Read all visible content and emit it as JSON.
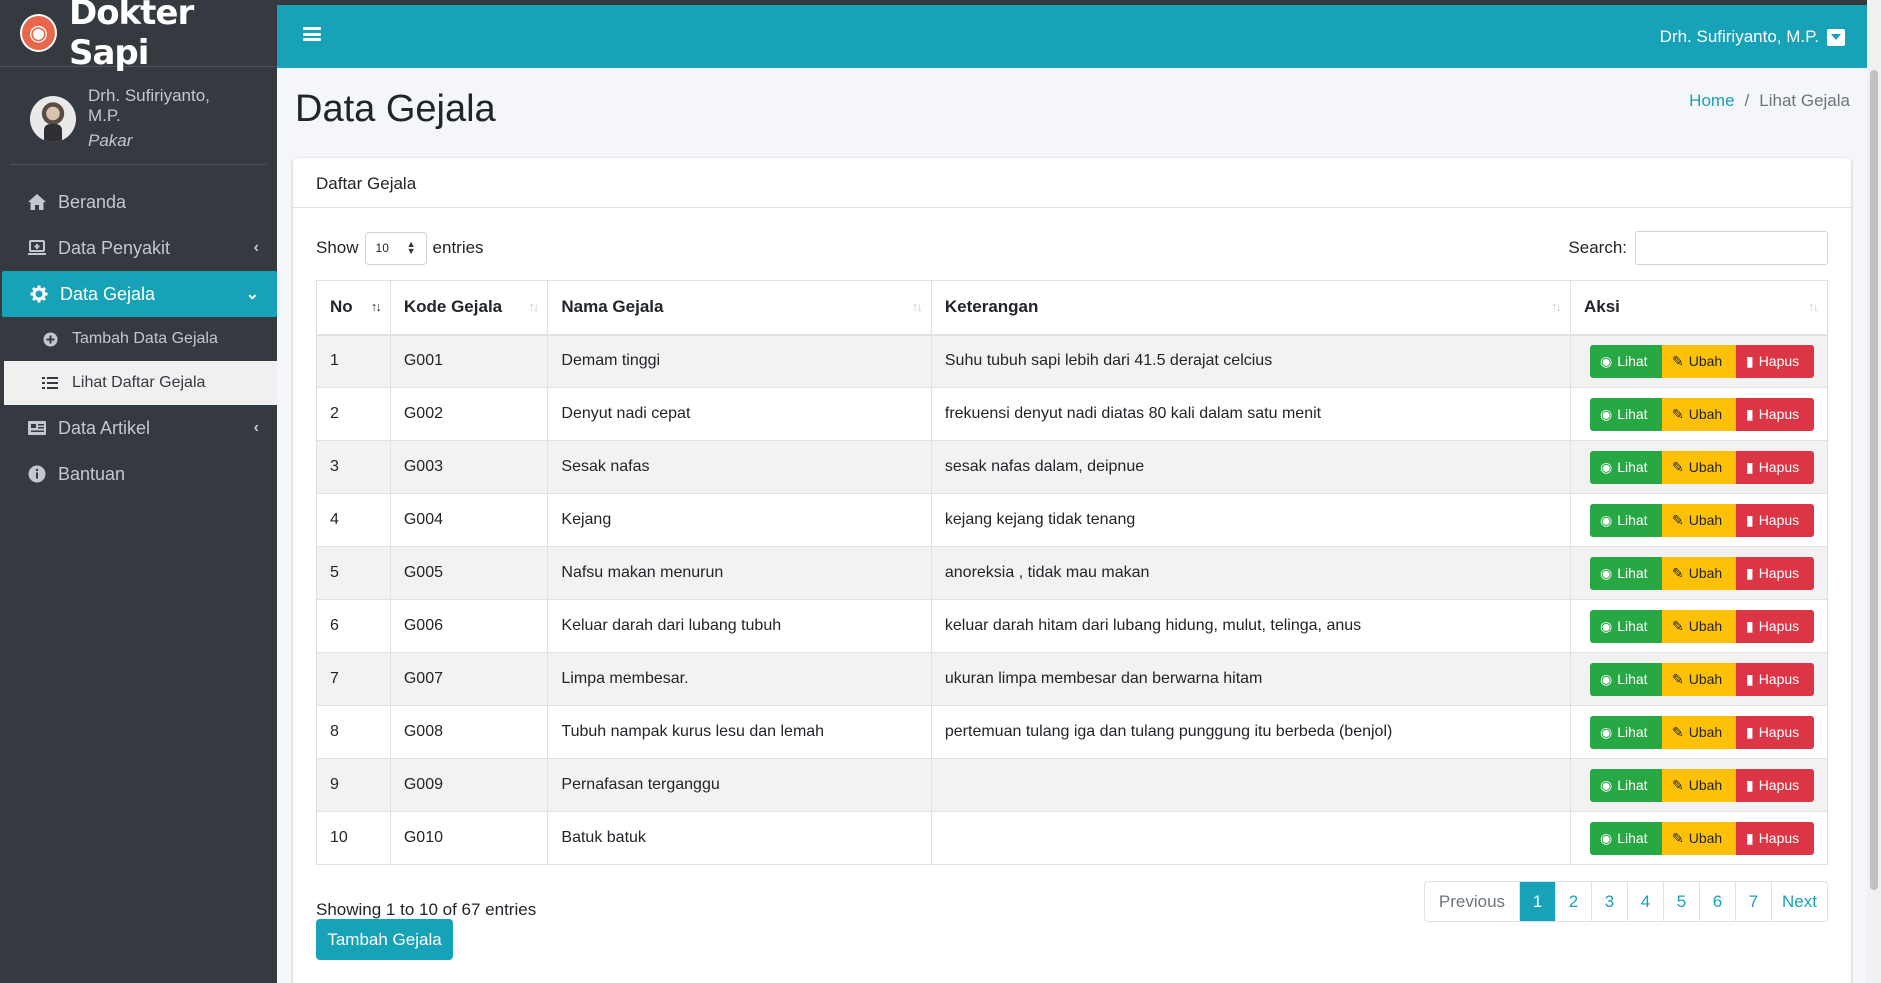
{
  "brand": {
    "name": "Dokter Sapi",
    "logo_icon": "cow-icon"
  },
  "sidebar": {
    "user": {
      "name": "Drh. Sufiriyanto, M.P.",
      "role": "Pakar"
    },
    "items": [
      {
        "label": "Beranda",
        "icon": "home-icon"
      },
      {
        "label": "Data Penyakit",
        "icon": "laptop-medical-icon"
      },
      {
        "label": "Data Gejala",
        "icon": "gear-icon"
      },
      {
        "label": "Data Artikel",
        "icon": "newspaper-icon"
      },
      {
        "label": "Bantuan",
        "icon": "info-icon"
      }
    ],
    "subitems": [
      {
        "label": "Tambah Data Gejala",
        "icon": "plus-circle-icon"
      },
      {
        "label": "Lihat Daftar Gejala",
        "icon": "list-icon"
      }
    ]
  },
  "topbar": {
    "user": "Drh. Sufiriyanto, M.P."
  },
  "page": {
    "title": "Data Gejala",
    "breadcrumb": {
      "home": "Home",
      "separator": "/",
      "current": "Lihat Gejala"
    }
  },
  "card": {
    "title": "Daftar Gejala"
  },
  "controls": {
    "show": "Show",
    "entries_value": "10",
    "entries": "entries",
    "search_label": "Search:"
  },
  "table": {
    "headers": [
      "No",
      "Kode Gejala",
      "Nama Gejala",
      "Keterangan",
      "Aksi"
    ],
    "rows": [
      {
        "no": "1",
        "kode": "G001",
        "nama": "Demam tinggi",
        "ket": "Suhu tubuh sapi lebih dari 41.5 derajat celcius"
      },
      {
        "no": "2",
        "kode": "G002",
        "nama": "Denyut nadi cepat",
        "ket": "frekuensi denyut nadi diatas 80 kali dalam satu menit"
      },
      {
        "no": "3",
        "kode": "G003",
        "nama": "Sesak nafas",
        "ket": "sesak nafas dalam, deipnue"
      },
      {
        "no": "4",
        "kode": "G004",
        "nama": "Kejang",
        "ket": "kejang kejang tidak tenang"
      },
      {
        "no": "5",
        "kode": "G005",
        "nama": "Nafsu makan menurun",
        "ket": "anoreksia , tidak mau makan"
      },
      {
        "no": "6",
        "kode": "G006",
        "nama": "Keluar darah dari lubang tubuh",
        "ket": "keluar darah hitam dari lubang hidung, mulut, telinga, anus"
      },
      {
        "no": "7",
        "kode": "G007",
        "nama": "Limpa membesar.",
        "ket": "ukuran limpa membesar dan berwarna hitam"
      },
      {
        "no": "8",
        "kode": "G008",
        "nama": "Tubuh nampak kurus lesu dan lemah",
        "ket": "pertemuan tulang iga dan tulang punggung itu berbeda (benjol)"
      },
      {
        "no": "9",
        "kode": "G009",
        "nama": "Pernafasan terganggu",
        "ket": ""
      },
      {
        "no": "10",
        "kode": "G010",
        "nama": "Batuk batuk",
        "ket": ""
      }
    ],
    "actions": {
      "view": "Lihat",
      "edit": "Ubah",
      "delete": "Hapus"
    }
  },
  "footer": {
    "info": "Showing 1 to 10 of 67 entries",
    "pagination": [
      "Previous",
      "1",
      "2",
      "3",
      "4",
      "5",
      "6",
      "7",
      "Next"
    ],
    "add_button": "Tambah Gejala"
  },
  "colors": {
    "accent": "#17a2b8",
    "sidebar": "#343a40",
    "success": "#28a745",
    "warning": "#ffc107",
    "danger": "#dc3545"
  }
}
